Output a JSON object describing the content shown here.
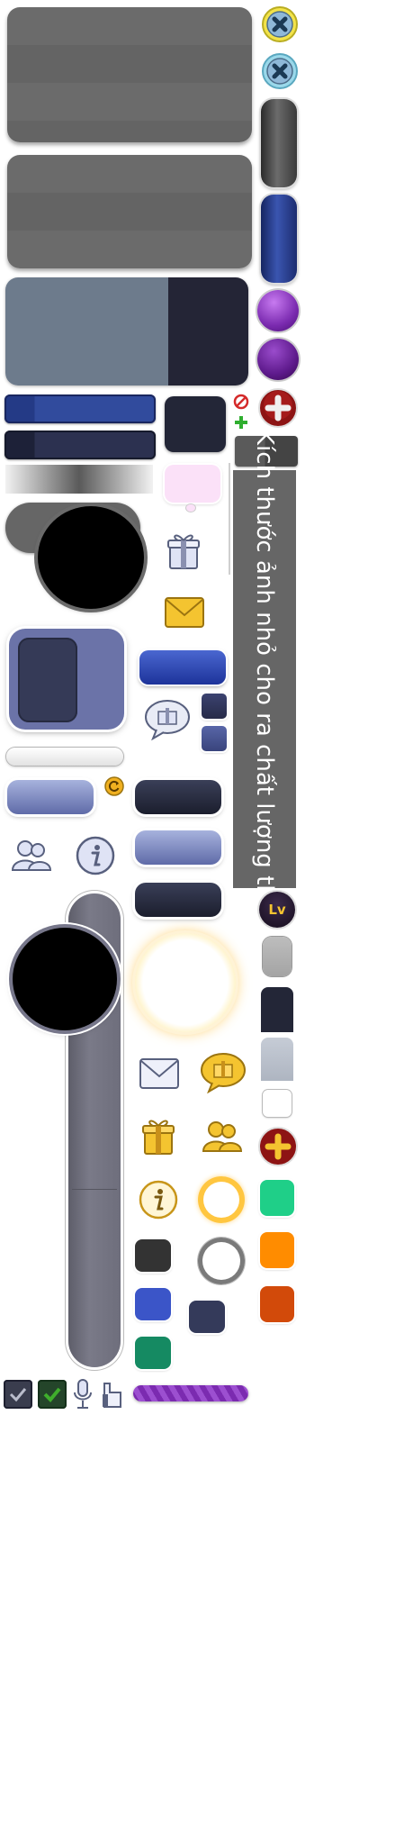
{
  "watermark": {
    "text": "Kích thước ảnh nhỏ cho ra chất lượng thấp"
  },
  "level_badge": {
    "label": "Lv"
  },
  "colors": {
    "panel_gray": "#666666",
    "slate": "#6d7b8c",
    "navy": "#242536",
    "royal_blue": "#2f4aa8",
    "purple": "#7b2bb0",
    "close_yellow": "#f3e34a",
    "close_cyan": "#9ad8ea",
    "gold": "#f4c430",
    "green_tile": "#1fcf88",
    "orange_tile": "#ff8c00",
    "rust_tile": "#d24a0a",
    "teal_tile": "#158a62",
    "check_green": "#3fae2c"
  },
  "icons": [
    "close-yellow-icon",
    "close-cyan-icon",
    "gift-icon",
    "mail-icon",
    "gift-bubble-icon",
    "friends-icon",
    "info-icon",
    "refresh-icon",
    "plus-icon",
    "mic-icon",
    "checkbox-icon"
  ]
}
